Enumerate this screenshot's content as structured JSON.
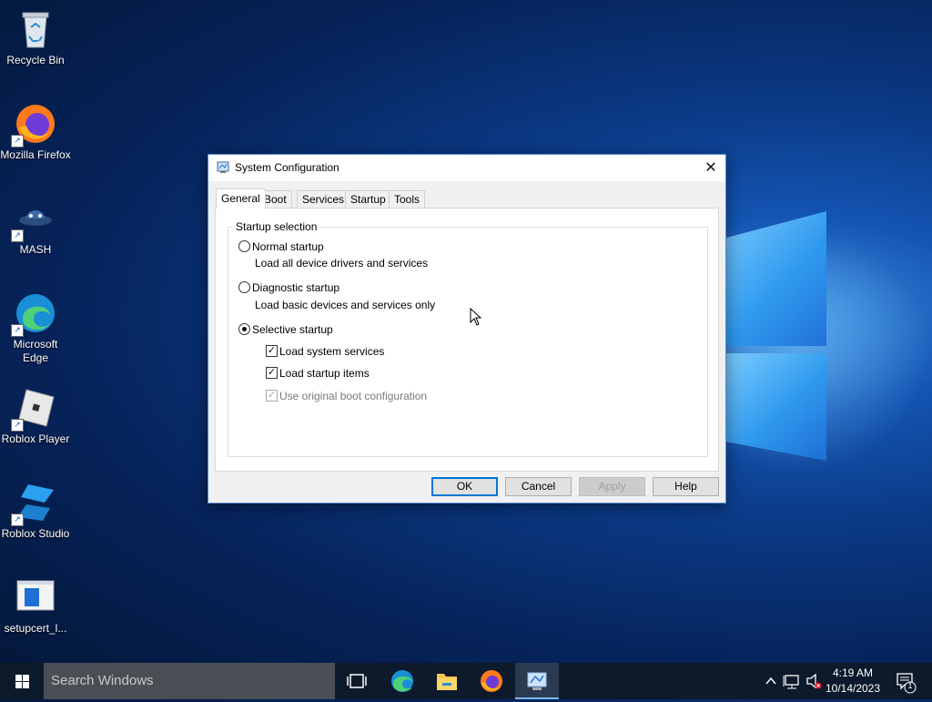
{
  "desktop": {
    "icons": [
      {
        "label": "Recycle Bin",
        "icon": "recycle-bin-icon"
      },
      {
        "label": "Mozilla Firefox",
        "icon": "firefox-icon"
      },
      {
        "label": "MASH",
        "icon": "mash-icon"
      },
      {
        "label": "Microsoft Edge",
        "icon": "edge-icon"
      },
      {
        "label": "Roblox Player",
        "icon": "roblox-player-icon"
      },
      {
        "label": "Roblox Studio",
        "icon": "roblox-studio-icon"
      },
      {
        "label": "setupcert_l...",
        "icon": "setup-file-icon"
      }
    ]
  },
  "dialog": {
    "title": "System Configuration",
    "tabs": [
      {
        "label": "General",
        "active": true
      },
      {
        "label": "Boot"
      },
      {
        "label": "Services"
      },
      {
        "label": "Startup"
      },
      {
        "label": "Tools"
      }
    ],
    "group_label": "Startup selection",
    "options": {
      "normal": {
        "label": "Normal startup",
        "desc": "Load all device drivers and services",
        "selected": false
      },
      "diagnostic": {
        "label": "Diagnostic startup",
        "desc": "Load basic devices and services only",
        "selected": false
      },
      "selective": {
        "label": "Selective startup",
        "selected": true
      }
    },
    "checkboxes": {
      "system_services": {
        "label": "Load system services",
        "checked": true
      },
      "startup_items": {
        "label": "Load startup items",
        "checked": true
      },
      "original_boot": {
        "label": "Use original boot configuration",
        "checked": true,
        "disabled": true
      }
    },
    "buttons": {
      "ok": "OK",
      "cancel": "Cancel",
      "apply": "Apply",
      "help": "Help"
    }
  },
  "taskbar": {
    "search_placeholder": "Search Windows",
    "time": "4:19 AM",
    "date": "10/14/2023",
    "notification_count": "1"
  }
}
